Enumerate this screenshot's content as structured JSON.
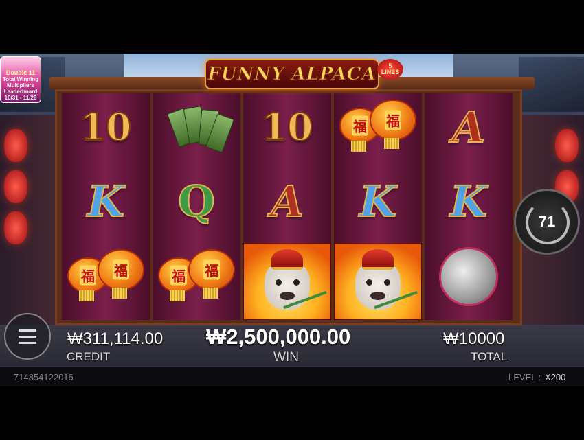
{
  "game": {
    "title": "FUNNY ALPACA",
    "lines_badge": {
      "number": "5",
      "word": "LINES"
    }
  },
  "promo": {
    "line1": "Double 11",
    "line2": "Total Winning",
    "line3": "Multipliers Leaderboard",
    "dates": "10/31 - 11/28"
  },
  "reels": [
    [
      {
        "type": "ten",
        "text": "10"
      },
      {
        "type": "k",
        "text": "K"
      },
      {
        "type": "lanterns",
        "text": "福"
      }
    ],
    [
      {
        "type": "tags",
        "text": ""
      },
      {
        "type": "q",
        "text": "Q"
      },
      {
        "type": "lanterns",
        "text": "福"
      }
    ],
    [
      {
        "type": "ten",
        "text": "10"
      },
      {
        "type": "a",
        "text": "A"
      },
      {
        "type": "alpaca",
        "text": ""
      }
    ],
    [
      {
        "type": "lanterns",
        "text": "福"
      },
      {
        "type": "k",
        "text": "K"
      },
      {
        "type": "alpaca",
        "text": ""
      }
    ],
    [
      {
        "type": "a",
        "text": "A"
      },
      {
        "type": "k",
        "text": "K"
      },
      {
        "type": "gong",
        "text": ""
      }
    ]
  ],
  "spin": {
    "count": "71"
  },
  "stats": {
    "credit_value": "₩311,114.00",
    "credit_label": "CREDIT",
    "win_value": "₩2,500,000.00",
    "win_label": "WIN",
    "total_value": "₩10000",
    "total_label": "TOTAL"
  },
  "footer": {
    "session_id": "714854122016",
    "level_label": "LEVEL :",
    "level_value": "X200"
  },
  "icons": {
    "menu": "hamburger-menu-icon",
    "spin": "auto-spin-icon"
  },
  "colors": {
    "reel_bg": "#6a1a40",
    "gold": "#f2b857",
    "win_text": "#ffffff"
  }
}
